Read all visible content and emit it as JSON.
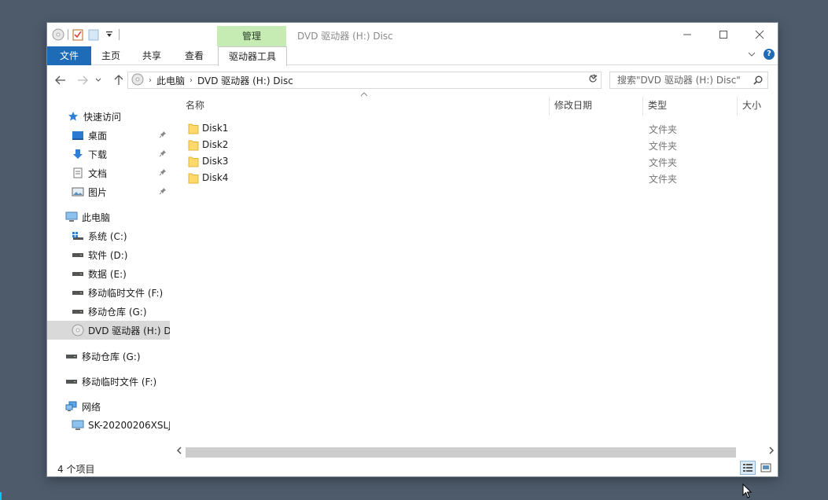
{
  "window": {
    "title": "DVD 驱动器 (H:) Disc",
    "tool_tab_group": "管理"
  },
  "ribbon": {
    "tabs": [
      {
        "label": "文件"
      },
      {
        "label": "主页"
      },
      {
        "label": "共享"
      },
      {
        "label": "查看"
      },
      {
        "label": "驱动器工具"
      }
    ],
    "help_glyph": "?"
  },
  "address": {
    "segments": [
      "此电脑",
      "DVD 驱动器 (H:) Disc"
    ],
    "search_placeholder": "搜索\"DVD 驱动器 (H:) Disc\""
  },
  "sidebar": {
    "quick_access": {
      "label": "快速访问",
      "icon": "star-icon"
    },
    "pinned": [
      {
        "label": "桌面",
        "icon": "desktop-icon"
      },
      {
        "label": "下载",
        "icon": "download-icon"
      },
      {
        "label": "文档",
        "icon": "document-icon"
      },
      {
        "label": "图片",
        "icon": "pictures-icon"
      }
    ],
    "this_pc": {
      "label": "此电脑",
      "icon": "computer-icon"
    },
    "drives": [
      {
        "label": "系统 (C:)",
        "icon": "system-drive-icon"
      },
      {
        "label": "软件 (D:)",
        "icon": "drive-icon"
      },
      {
        "label": "数据 (E:)",
        "icon": "drive-icon"
      },
      {
        "label": "移动临时文件 (F:)",
        "icon": "drive-icon"
      },
      {
        "label": "移动仓库 (G:)",
        "icon": "drive-icon"
      },
      {
        "label": "DVD 驱动器 (H:) D",
        "icon": "dvd-icon",
        "selected": true
      }
    ],
    "removable": [
      {
        "label": "移动仓库 (G:)",
        "icon": "drive-icon"
      },
      {
        "label": "移动临时文件 (F:)",
        "icon": "drive-icon"
      }
    ],
    "network": {
      "label": "网络",
      "icon": "network-icon"
    },
    "network_items": [
      {
        "label": "SK-20200206XSLJ",
        "icon": "computer-icon"
      }
    ]
  },
  "columns": [
    "名称",
    "修改日期",
    "类型",
    "大小"
  ],
  "files": [
    {
      "name": "Disk1",
      "type": "文件夹"
    },
    {
      "name": "Disk2",
      "type": "文件夹"
    },
    {
      "name": "Disk3",
      "type": "文件夹"
    },
    {
      "name": "Disk4",
      "type": "文件夹"
    }
  ],
  "status": {
    "item_count": "4 个项目"
  },
  "colors": {
    "file_tab": "#1e6bb8",
    "tool_tab": "#c6ecb3",
    "desktop_bg": "#4e5b6b",
    "folder": "#ffd96b"
  }
}
